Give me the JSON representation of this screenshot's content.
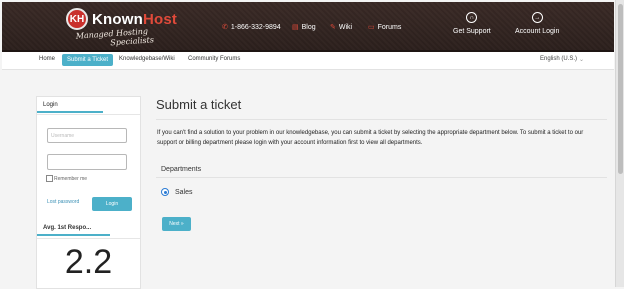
{
  "header": {
    "logo_badge": "KH",
    "logo_known": "Known",
    "logo_host": "Host",
    "tagline_line1": "Managed Hosting",
    "tagline_line2": "Specialists",
    "phone": "1-866-332-9894",
    "blog": "Blog",
    "wiki": "Wiki",
    "forums": "Forums",
    "get_support": "Get Support",
    "account_login": "Account Login"
  },
  "subnav": {
    "home": "Home",
    "submit_ticket": "Submit a Ticket",
    "knowledgebase": "Knowledgebase/Wiki",
    "community_forums": "Community Forums",
    "language": "English (U.S.)"
  },
  "sidebar": {
    "login_tab": "Login",
    "username_placeholder": "Username",
    "remember_me": "Remember me",
    "lost_password": "Lost password",
    "login_button": "Login",
    "response_heading": "Avg. 1st Respo...",
    "response_value": "2.2"
  },
  "main": {
    "title": "Submit a ticket",
    "intro": "If you can't find a solution to your problem in our knowledgebase, you can submit a ticket by selecting the appropriate department below. To submit a ticket to our support or billing department please login with your account information first to view all departments.",
    "departments_label": "Departments",
    "department_option": "Sales",
    "next_button": "Next »"
  },
  "colors": {
    "accent": "#4cb0c9",
    "header_bg": "#2c201d",
    "brand_red": "#e04a3a"
  }
}
